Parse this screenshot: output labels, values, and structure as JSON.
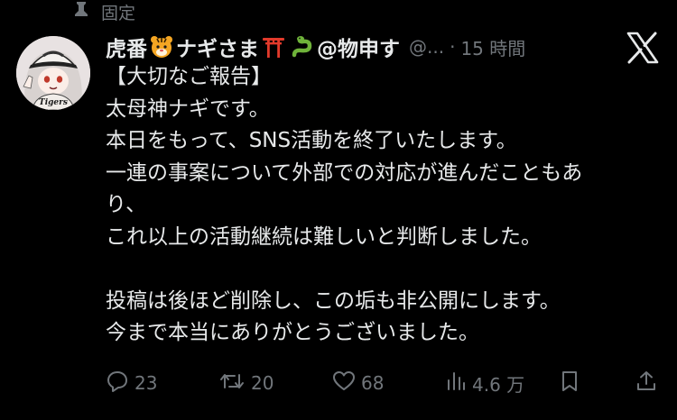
{
  "pinned": {
    "label": "固定",
    "icon": "pin-icon"
  },
  "tweet": {
    "author": {
      "name_part1": "虎番",
      "name_part2": "ナギさま",
      "name_part3": "@物申す",
      "emojis": [
        "tiger-face-emoji",
        "torii-gate-emoji",
        "snake-emoji"
      ],
      "handle": "@...",
      "separator": "·",
      "timestamp": "15 時間",
      "avatar_text": "Tigers"
    },
    "body_lines": [
      "【大切なご報告】",
      "太母神ナギです。",
      "本日をもって、SNS活動を終了いたします。",
      "一連の事案について外部での対応が進んだこともあ",
      "り、",
      "これ以上の活動継続は難しいと判断しました。",
      "",
      "投稿は後ほど削除し、この垢も非公開にします。",
      "今まで本当にありがとうございました。"
    ],
    "stats": {
      "replies": "23",
      "retweets": "20",
      "likes": "68",
      "views": "4.6 万"
    }
  },
  "colors": {
    "background": "#000000",
    "text_primary": "#e7e9ea",
    "text_secondary": "#71767b"
  },
  "icons": [
    "pin-icon",
    "x-logo-icon",
    "reply-icon",
    "retweet-icon",
    "like-icon",
    "views-icon",
    "bookmark-icon",
    "share-icon"
  ]
}
